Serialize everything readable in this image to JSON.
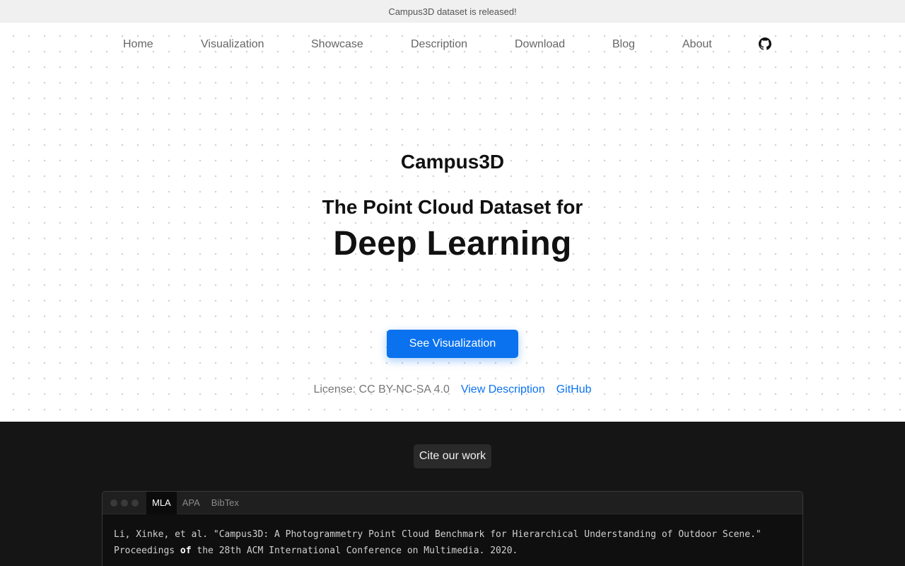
{
  "announcement": "Campus3D dataset is released!",
  "nav": {
    "home": "Home",
    "visualization": "Visualization",
    "showcase": "Showcase",
    "description": "Description",
    "download": "Download",
    "blog": "Blog",
    "about": "About",
    "github_icon": "github-icon"
  },
  "hero": {
    "name": "Campus3D",
    "tagline": "The Point Cloud Dataset for",
    "headline": "Deep Learning",
    "cta_label": "See Visualization",
    "license": "License: CC BY-NC-SA 4.0",
    "view_description": "View Description",
    "github": "GitHub"
  },
  "cite": {
    "label": "Cite our work",
    "tabs": [
      "MLA",
      "APA",
      "BibTex"
    ],
    "active_tab": "MLA",
    "line1": "Li, Xinke, et al. \"Campus3D: A Photogrammetry Point Cloud Benchmark for Hierarchical Understanding of Outdoor Scene.\"",
    "line2_pre": "Proceedings ",
    "line2_kw": "of",
    "line2_post": " the 28th ACM International Conference on Multimedia. 2020."
  },
  "colors": {
    "accent": "#0a72ef",
    "dark_bg": "#151515"
  }
}
